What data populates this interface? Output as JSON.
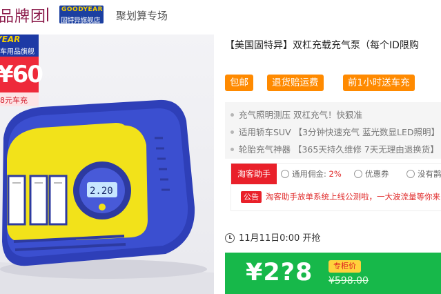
{
  "header": {
    "brand_title": "品牌团",
    "logo_text_1": "GOODYEAR",
    "logo_text_2": "固特异旗舰店",
    "sub_title": "聚划算专场"
  },
  "image": {
    "badge_brand_1": "YEAR",
    "badge_brand_2": "车用品旗舰店",
    "badge_price": "¥60",
    "badge_tag": "8元车充",
    "gauge_display": "2.20"
  },
  "product": {
    "title": "【美国固特异】双杠充载充气泵（每个ID限购",
    "tags": [
      "包邮",
      "退货赔运费",
      "前1小时送车充"
    ],
    "features": [
      "充气照明测压 双杠充气！快狠准",
      "适用轿车SUV 【3分钟快速充气 蓝光数显LED照明】",
      "轮胎充气神器 【365天持久维修 7天无理由退换货】"
    ]
  },
  "assistant": {
    "label": "淘客助手",
    "commission_label": "通用佣金: ",
    "commission_value": "2%",
    "coupon_label": "优惠券",
    "no_plan_label": "没有鹊桥",
    "notice_label": "公告",
    "notice_text": "淘客助手放单系统上线公测啦，一大波流量等你来"
  },
  "sale": {
    "start_time": "11月11日0:00 开抢",
    "price": "¥2?8",
    "counter_label": "专柜价",
    "old_price": "¥598.00"
  },
  "colors": {
    "accent_orange": "#ff8a00",
    "price_green": "#17b84a",
    "alert_red": "#e9202a",
    "brand_blue": "#1d3aa5"
  }
}
